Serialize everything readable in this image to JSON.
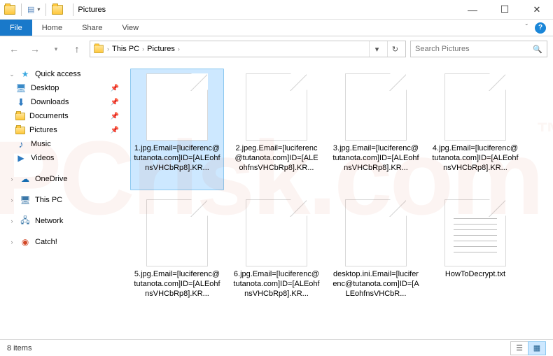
{
  "titlebar": {
    "app_label": "Pictures"
  },
  "window_controls": {
    "min": "—",
    "max": "☐",
    "close": "✕"
  },
  "ribbon": {
    "file": "File",
    "tabs": [
      "Home",
      "Share",
      "View"
    ]
  },
  "nav": {
    "back_glyph": "←",
    "forward_glyph": "→",
    "recent_glyph": "▾",
    "up_glyph": "↑"
  },
  "address": {
    "crumbs": [
      "This PC",
      "Pictures"
    ],
    "sep": "›",
    "dropdown_glyph": "▾",
    "refresh_glyph": "↻"
  },
  "search": {
    "placeholder": "Search Pictures",
    "mag": "🔍"
  },
  "sidebar": {
    "quick_access": {
      "label": "Quick access",
      "items": [
        {
          "label": "Desktop",
          "pinned": true
        },
        {
          "label": "Downloads",
          "pinned": true
        },
        {
          "label": "Documents",
          "pinned": true
        },
        {
          "label": "Pictures",
          "pinned": true
        },
        {
          "label": "Music",
          "pinned": false
        },
        {
          "label": "Videos",
          "pinned": false
        }
      ]
    },
    "onedrive": "OneDrive",
    "this_pc": "This PC",
    "network": "Network",
    "catch": "Catch!"
  },
  "files": [
    {
      "name": "1.jpg.Email=[luciferenc@tutanota.com]ID=[ALEohfnsVHCbRp8].KR...",
      "type": "blank",
      "selected": true
    },
    {
      "name": "2.jpeg.Email=[luciferenc@tutanota.com]ID=[ALEohfnsVHCbRp8].KR...",
      "type": "blank",
      "selected": false
    },
    {
      "name": "3.jpg.Email=[luciferenc@tutanota.com]ID=[ALEohfnsVHCbRp8].KR...",
      "type": "blank",
      "selected": false
    },
    {
      "name": "4.jpg.Email=[luciferenc@tutanota.com]ID=[ALEohfnsVHCbRp8].KR...",
      "type": "blank",
      "selected": false
    },
    {
      "name": "5.jpg.Email=[luciferenc@tutanota.com]ID=[ALEohfnsVHCbRp8].KR...",
      "type": "blank",
      "selected": false
    },
    {
      "name": "6.jpg.Email=[luciferenc@tutanota.com]ID=[ALEohfnsVHCbRp8].KR...",
      "type": "blank",
      "selected": false
    },
    {
      "name": "desktop.ini.Email=[luciferenc@tutanota.com]ID=[ALEohfnsVHCbR...",
      "type": "blank",
      "selected": false
    },
    {
      "name": "HowToDecrypt.txt",
      "type": "txt",
      "selected": false
    }
  ],
  "status": {
    "count_label": "8 items"
  },
  "pin_glyph": "📌",
  "watermark": {
    "text": "PCrisk.com",
    "tm": "™"
  }
}
